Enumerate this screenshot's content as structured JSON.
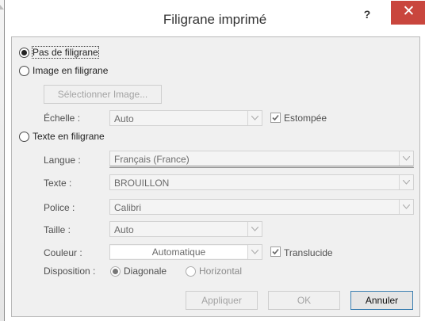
{
  "dialog": {
    "title": "Filigrane imprimé",
    "help_label": "?",
    "close_label": "✕"
  },
  "options": {
    "none_label": "Pas de filigrane",
    "none_selected": true,
    "image_label": "Image en filigrane",
    "select_image_button": "Sélectionner Image...",
    "scale_label": "Échelle :",
    "scale_value": "Auto",
    "washout_label": "Estompée",
    "washout_checked": true,
    "text_label": "Texte en filigrane"
  },
  "text_options": {
    "language_label": "Langue :",
    "language_value": "Français (France)",
    "text_label": "Texte :",
    "text_value": "BROUILLON",
    "font_label": "Police :",
    "font_value": "Calibri",
    "size_label": "Taille :",
    "size_value": "Auto",
    "color_label": "Couleur :",
    "color_value": "Automatique",
    "semitransparent_label": "Translucide",
    "semitransparent_checked": true,
    "layout_label": "Disposition :",
    "layout_diagonal": "Diagonale",
    "layout_horizontal": "Horizontal",
    "layout_selected": "Diagonale"
  },
  "buttons": {
    "apply": "Appliquer",
    "ok": "OK",
    "cancel": "Annuler"
  },
  "colors": {
    "close_button": "#c9463d",
    "dialog_bg": "#f0f0f0",
    "default_button_border": "#3c7fb1"
  }
}
